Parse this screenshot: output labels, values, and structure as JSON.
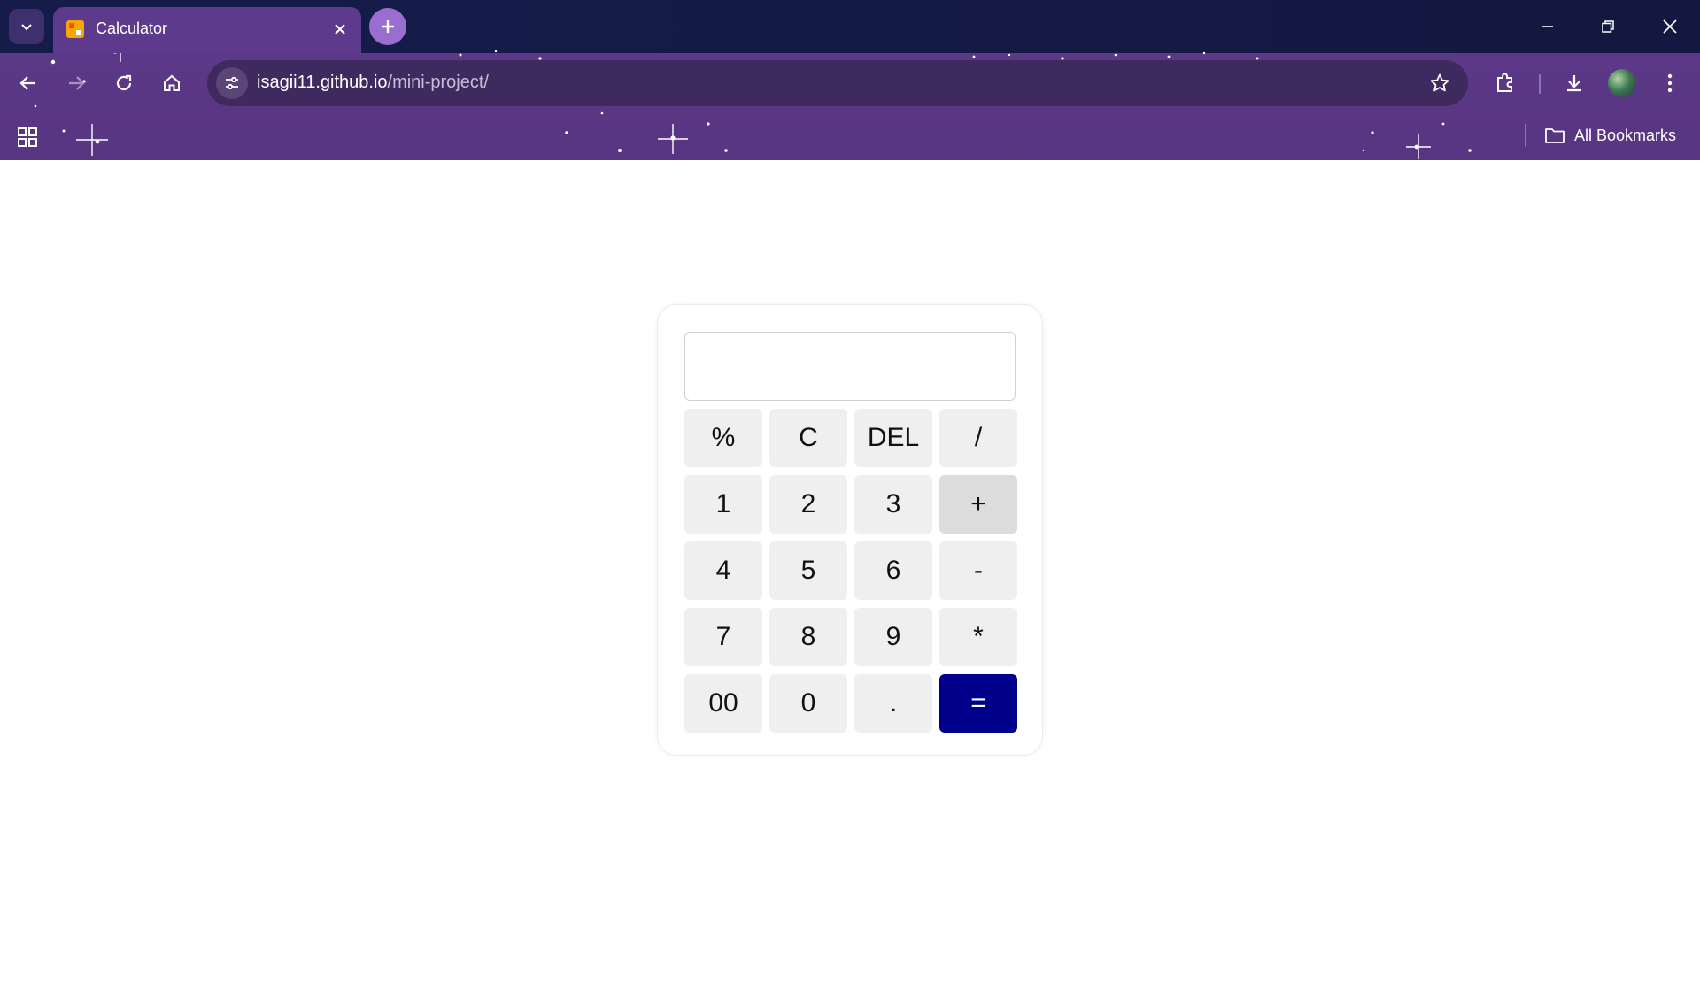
{
  "browser": {
    "tab": {
      "title": "Calculator",
      "favicon": "calculator-favicon"
    },
    "url": {
      "host": "isagii11.github.io",
      "path": "/mini-project/"
    },
    "bookmarks_bar": {
      "all_bookmarks_label": "All Bookmarks"
    },
    "icons": {
      "tab_list": "chevron-down-icon",
      "close_tab": "close-icon",
      "new_tab": "plus-icon",
      "minimize": "minimize-icon",
      "restore": "restore-icon",
      "close_window": "close-icon",
      "back": "arrow-left-icon",
      "forward": "arrow-right-icon",
      "reload": "reload-icon",
      "home": "home-icon",
      "site_info": "tune-icon",
      "bookmark_star": "star-icon",
      "extensions": "puzzle-icon",
      "downloads": "download-icon",
      "menu": "kebab-menu-icon",
      "apps": "apps-grid-icon",
      "folder": "folder-icon"
    },
    "theme": {
      "titlebar": "#141a45",
      "toolbar": "#5e3a8c",
      "accent": "#9a6ed0"
    }
  },
  "calculator": {
    "display_value": "",
    "keys": [
      [
        "%",
        "C",
        "DEL",
        "/"
      ],
      [
        "1",
        "2",
        "3",
        "+"
      ],
      [
        "4",
        "5",
        "6",
        "-"
      ],
      [
        "7",
        "8",
        "9",
        "*"
      ],
      [
        "00",
        "0",
        ".",
        "="
      ]
    ],
    "hovered_key": "+",
    "colors": {
      "key": "#efefef",
      "key_hover": "#dcdcdc",
      "equals": "#00008b",
      "equals_text": "#ffffff"
    }
  }
}
